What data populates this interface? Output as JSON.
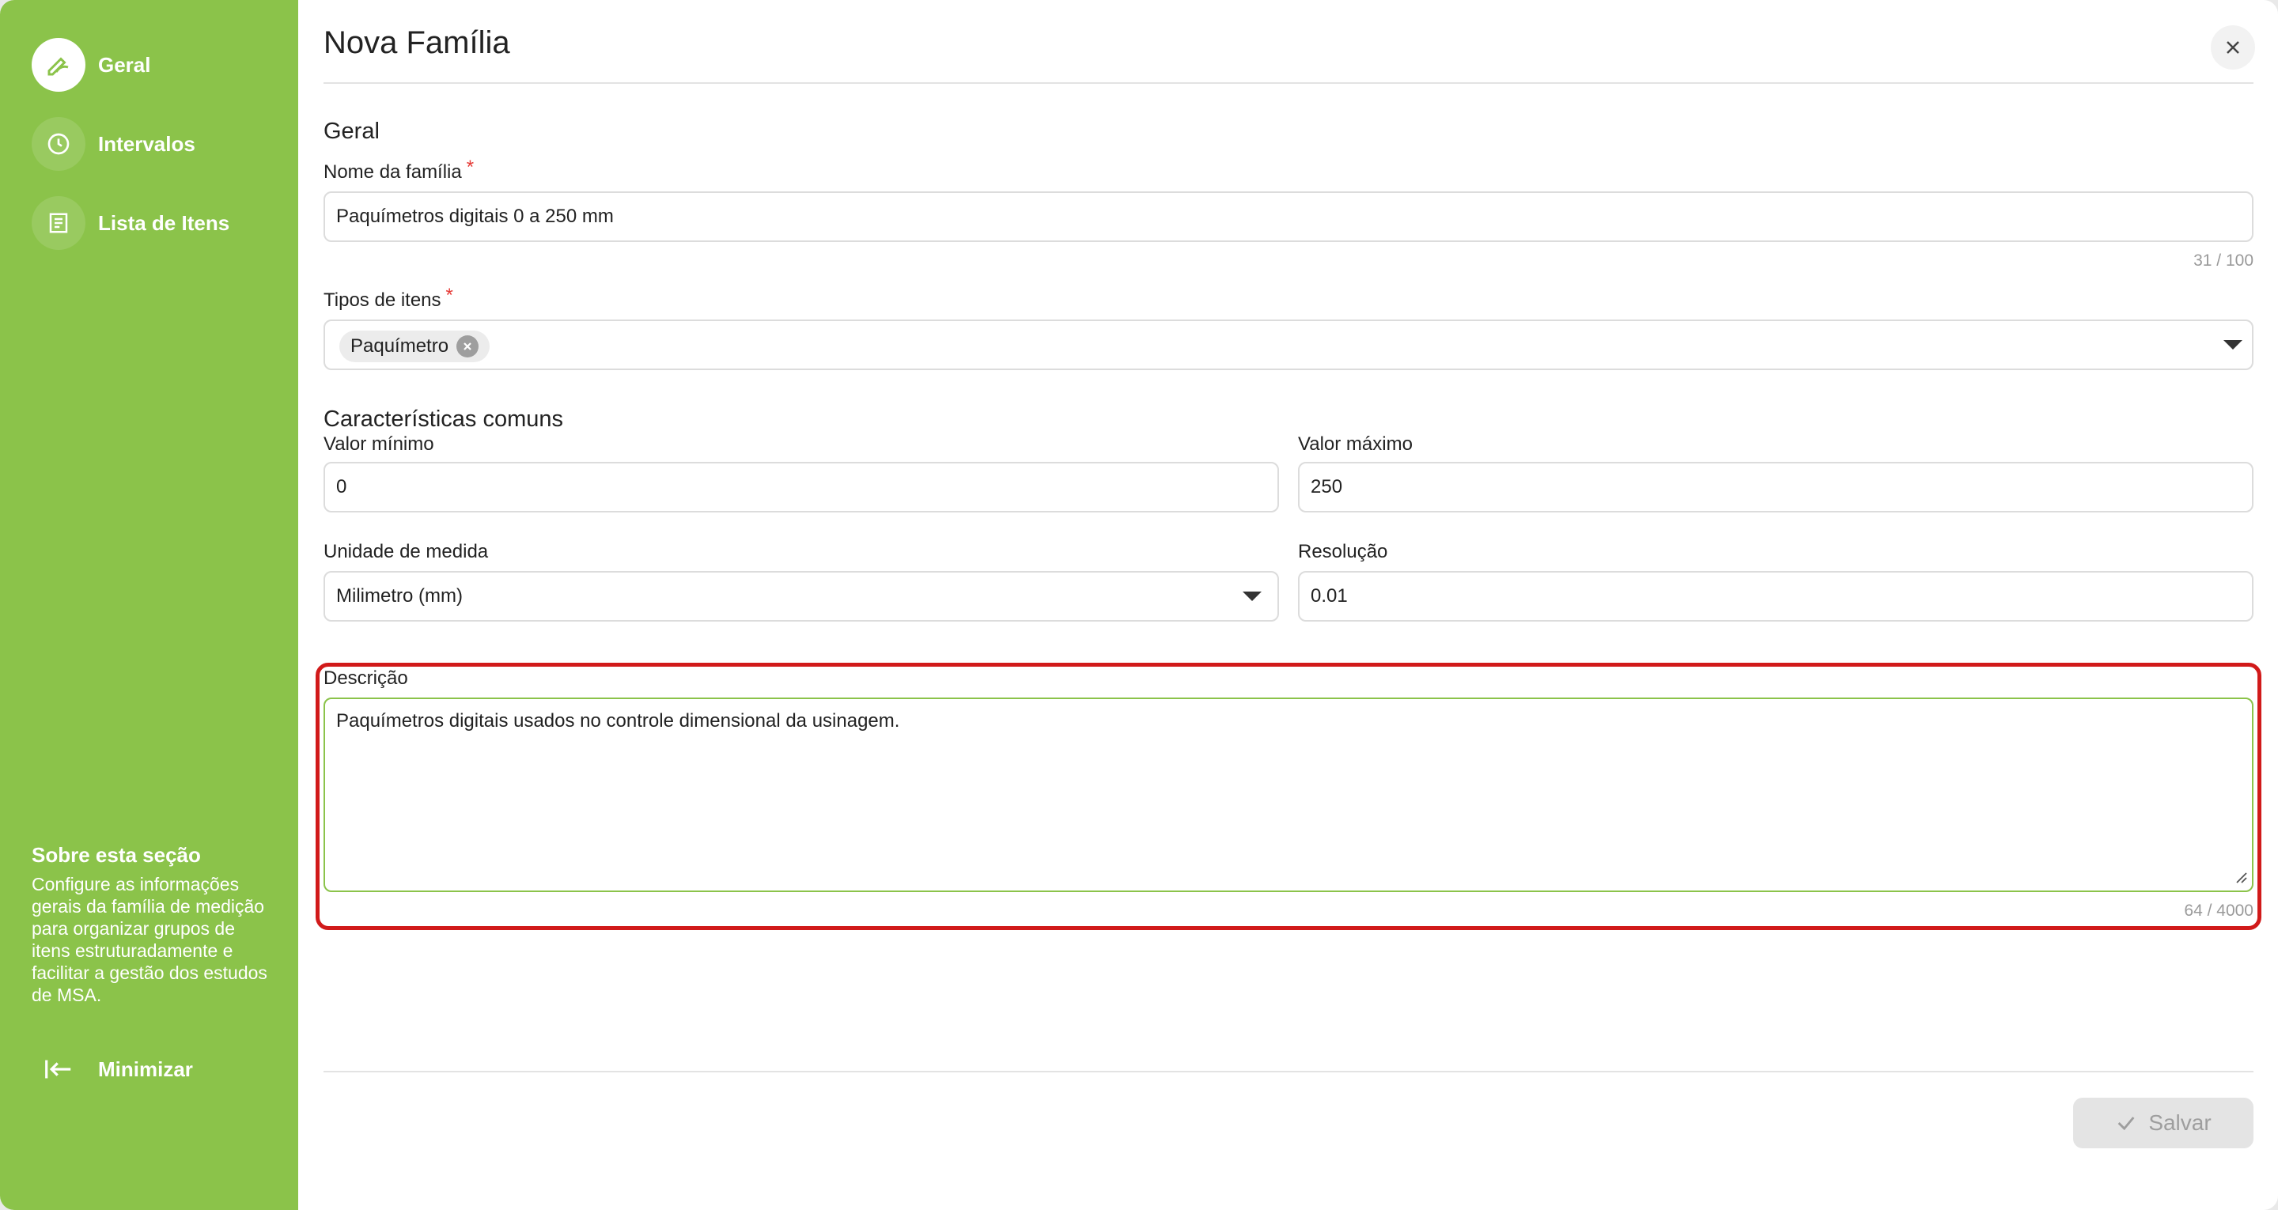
{
  "sidebar": {
    "items": [
      {
        "label": "Geral",
        "icon": "pencil-icon",
        "active": true
      },
      {
        "label": "Intervalos",
        "icon": "clock-icon",
        "active": false
      },
      {
        "label": "Lista de Itens",
        "icon": "list-icon",
        "active": false
      }
    ],
    "about_title": "Sobre esta seção",
    "about_text": "Configure as informações gerais da família de medição para organizar grupos de itens estruturadamente e facilitar a gestão dos estudos de MSA.",
    "minimize_label": "Minimizar"
  },
  "header": {
    "title": "Nova Família"
  },
  "form": {
    "section_general": "Geral",
    "family_name": {
      "label": "Nome da família",
      "value": "Paquímetros digitais 0 a 250 mm",
      "counter": "31 / 100"
    },
    "item_types": {
      "label": "Tipos de itens",
      "chips": [
        "Paquímetro"
      ]
    },
    "section_common": "Características comuns",
    "min_value": {
      "label": "Valor mínimo",
      "value": "0"
    },
    "max_value": {
      "label": "Valor máximo",
      "value": "250"
    },
    "unit": {
      "label": "Unidade de medida",
      "value": "Milimetro (mm)"
    },
    "resolution": {
      "label": "Resolução",
      "value": "0.01"
    },
    "description": {
      "label": "Descrição",
      "value": "Paquímetros digitais usados no controle dimensional da usinagem.",
      "counter": "64 / 4000"
    }
  },
  "footer": {
    "save_label": "Salvar"
  },
  "colors": {
    "sidebar": "#8bc34a",
    "highlight": "#d11a1a",
    "required": "#e53935"
  }
}
